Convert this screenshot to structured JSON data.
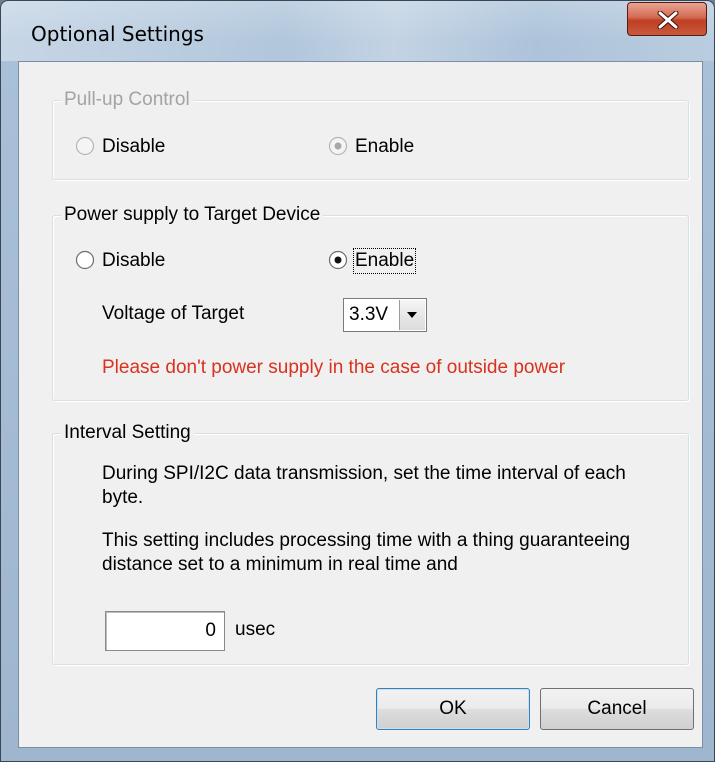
{
  "window": {
    "title": "Optional Settings"
  },
  "pullup": {
    "legend": "Pull-up Control",
    "disable_label": "Disable",
    "enable_label": "Enable",
    "selected": "enable",
    "disabled": true
  },
  "power": {
    "legend": "Power supply to Target Device",
    "disable_label": "Disable",
    "enable_label": "Enable",
    "selected": "enable",
    "voltage_label": "Voltage of Target",
    "voltage_value": "3.3V",
    "warning": "Please don't power supply in the case of outside power",
    "warning_color": "#d9321f"
  },
  "interval": {
    "legend": "Interval Setting",
    "desc1": "During SPI/I2C data transmission, set the time interval of each byte.",
    "desc2": "This setting includes processing time with a thing guaranteeing distance set to a minimum in real time and",
    "value": "0",
    "unit": "usec"
  },
  "buttons": {
    "ok": "OK",
    "cancel": "Cancel"
  },
  "icons": {
    "close": "close-icon",
    "dropdown": "chevron-down-icon"
  }
}
